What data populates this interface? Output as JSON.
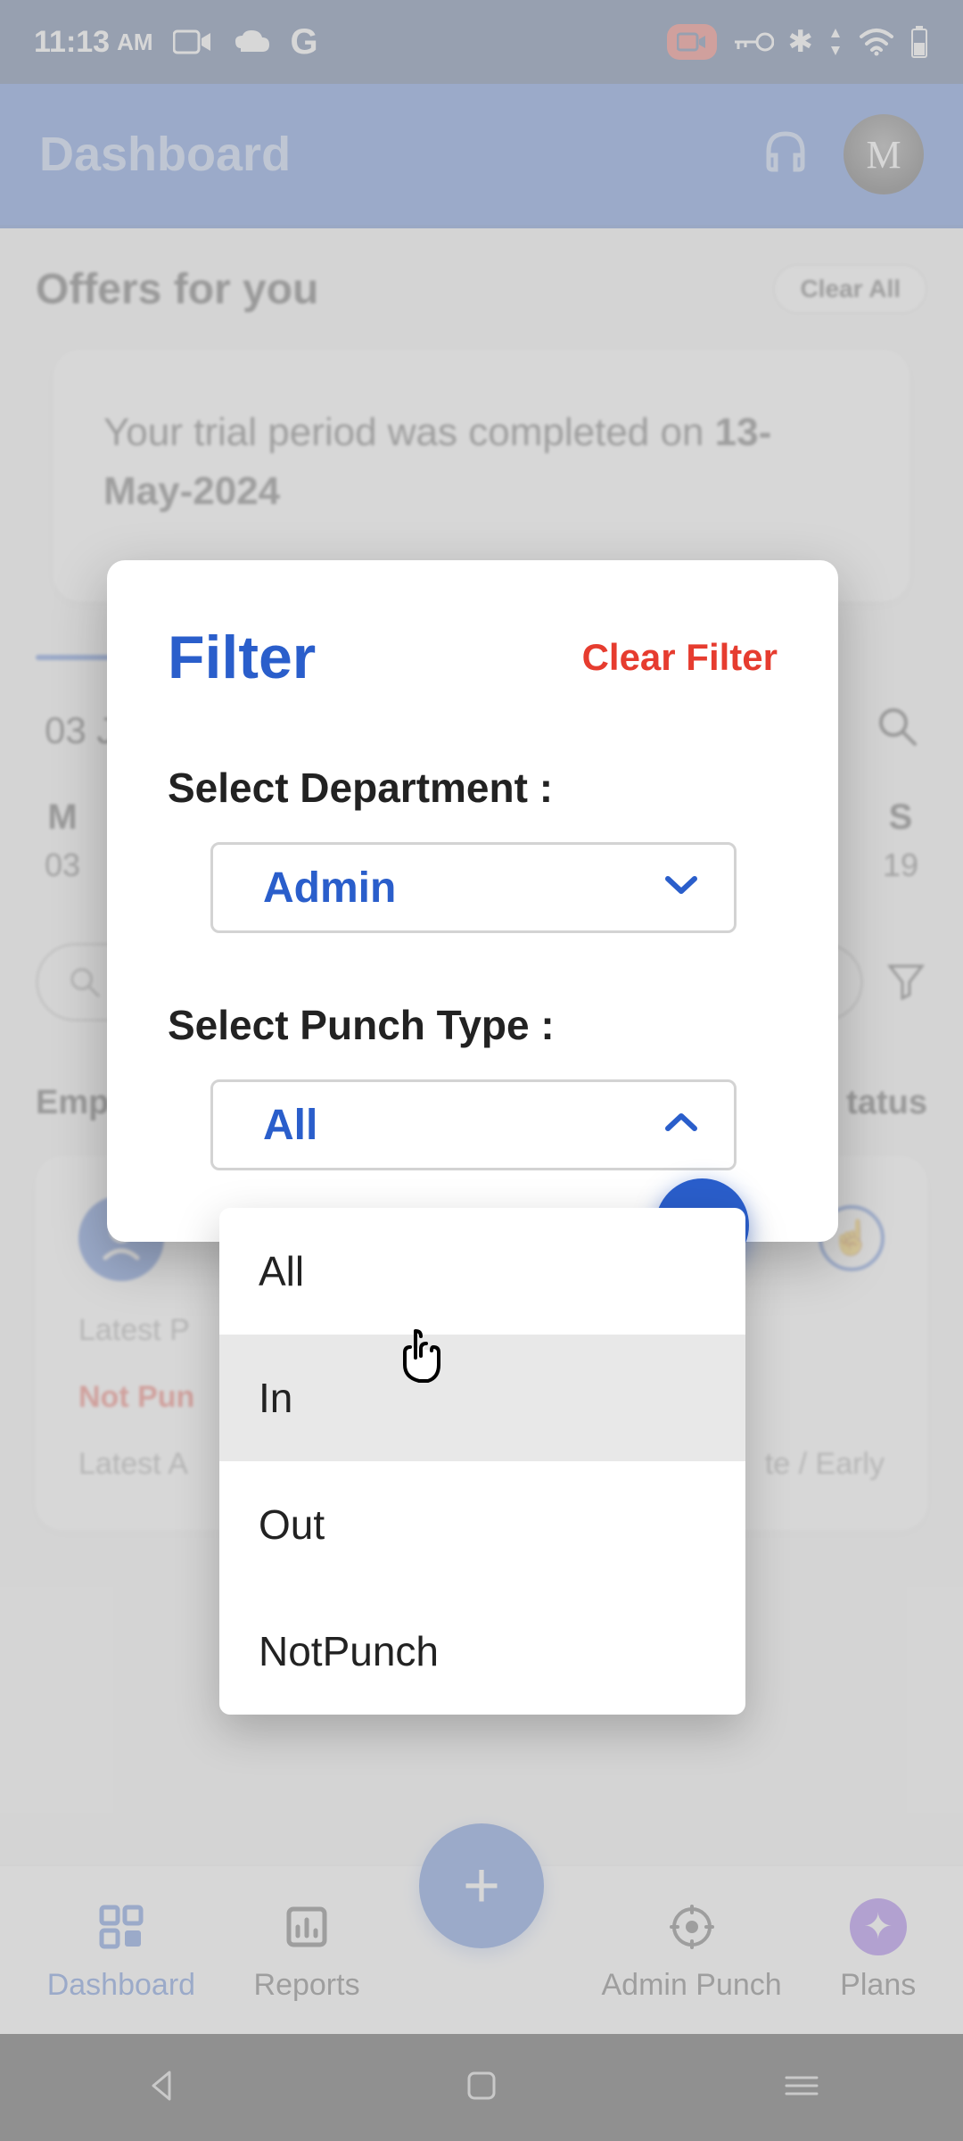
{
  "status": {
    "time": "11:13",
    "ampm": "AM"
  },
  "header": {
    "title": "Dashboard"
  },
  "offers": {
    "title": "Offers for you",
    "clear_all": "Clear All",
    "trial_prefix": "Your trial period was completed on ",
    "trial_date": "13-May-2024"
  },
  "date": {
    "left": "03 J",
    "day_m": "M",
    "day_m_num": "03",
    "day_s": "S",
    "day_s_num": "19"
  },
  "list": {
    "header_left": "Empl",
    "header_right": "tatus",
    "latest_p": "Latest P",
    "not_punched": "Not Pun",
    "latest_a": "Latest A",
    "late_early": "te / Early"
  },
  "nav": {
    "dashboard": "Dashboard",
    "reports": "Reports",
    "admin_punch": "Admin Punch",
    "plans": "Plans"
  },
  "dialog": {
    "title": "Filter",
    "clear": "Clear Filter",
    "dept_label": "Select Department :",
    "dept_value": "Admin",
    "punch_label": "Select Punch Type :",
    "punch_value": "All",
    "options": {
      "all": "All",
      "in": "In",
      "out": "Out",
      "notpunch": "NotPunch"
    }
  }
}
